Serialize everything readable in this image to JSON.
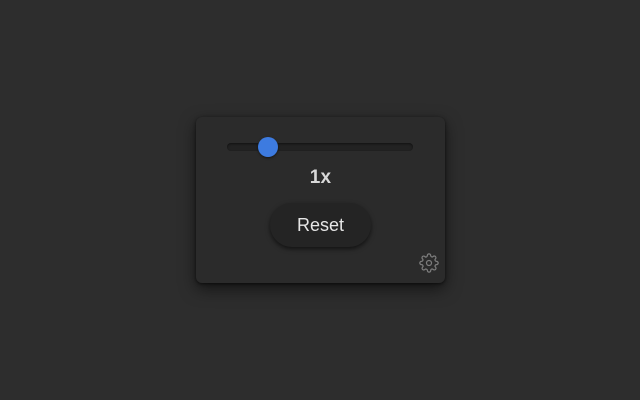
{
  "speed_control": {
    "slider": {
      "value_fraction": 0.22
    },
    "speed_label": "1x",
    "reset_label": "Reset",
    "settings_icon": "gear-icon"
  },
  "colors": {
    "background": "#2d2d2d",
    "panel": "#2b2b2b",
    "track": "#222222",
    "thumb": "#3d7be0",
    "text": "#d8d8d8"
  }
}
